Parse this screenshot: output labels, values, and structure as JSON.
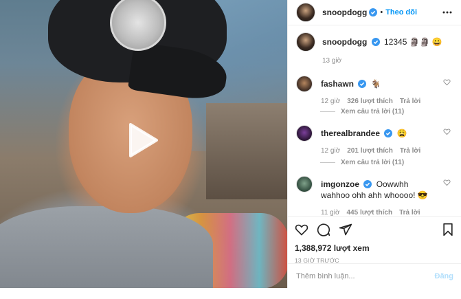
{
  "post": {
    "author": "snoopdogg",
    "follow_label": "Theo dõi",
    "separator": "•",
    "caption_text": "12345 🗿🗿 😀",
    "caption_time": "13 giờ"
  },
  "comments": [
    {
      "user": "fashawn",
      "text": "🐐",
      "time": "12 giờ",
      "likes": "326 lượt thích",
      "reply": "Trả lời",
      "view_replies": "Xem câu trả lời (11)"
    },
    {
      "user": "therealbrandee",
      "text": "😩",
      "time": "12 giờ",
      "likes": "201 lượt thích",
      "reply": "Trả lời",
      "view_replies": "Xem câu trả lời (11)"
    },
    {
      "user": "imgonzoe",
      "text": "Oowwhh wahhoo ohh ahh whoooo! 😎",
      "time": "11 giờ",
      "likes": "445 lượt thích",
      "reply": "Trả lời"
    }
  ],
  "stats": {
    "views": "1,388,972 lượt xem",
    "ago": "13 GIỜ TRƯỚC"
  },
  "comment_box": {
    "placeholder": "Thêm bình luận...",
    "post_label": "Đăng"
  },
  "colors": {
    "accent": "#0095f6",
    "verified": "#3897f0",
    "muted": "#8e8e8e"
  },
  "icons": [
    "play-icon",
    "verified-badge-icon",
    "more-options-icon",
    "heart-icon",
    "comment-icon",
    "share-icon",
    "bookmark-icon"
  ]
}
